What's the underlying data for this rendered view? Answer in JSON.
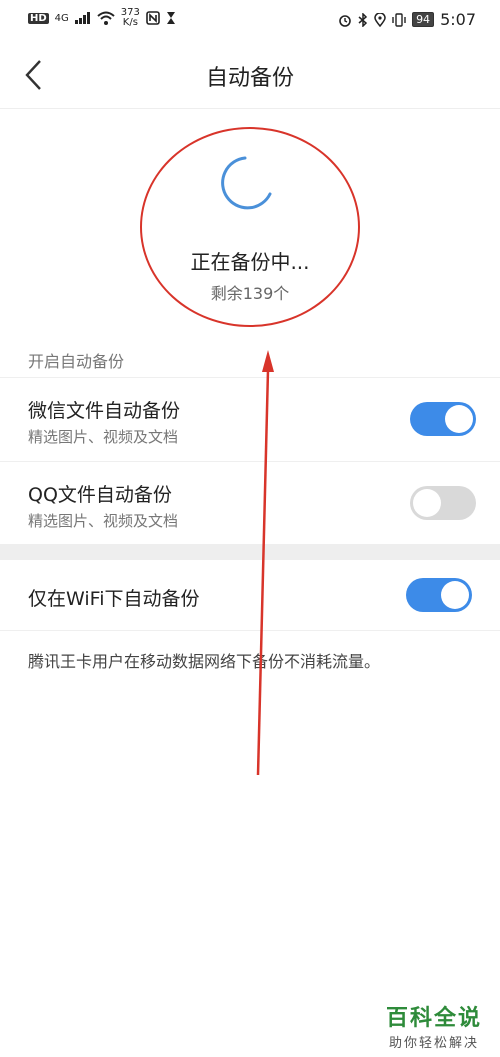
{
  "status_bar": {
    "network": "HD",
    "signal": "4G",
    "speed_value": "373",
    "speed_unit": "K/s",
    "battery": "94",
    "time": "5:07"
  },
  "nav": {
    "title": "自动备份"
  },
  "backup_status": {
    "text": "正在备份中...",
    "remaining": "剩余139个"
  },
  "section": {
    "header": "开启自动备份"
  },
  "rows": [
    {
      "title": "微信文件自动备份",
      "subtitle": "精选图片、视频及文档",
      "enabled": true
    },
    {
      "title": "QQ文件自动备份",
      "subtitle": "精选图片、视频及文档",
      "enabled": false
    }
  ],
  "wifi_row": {
    "title": "仅在WiFi下自动备份",
    "enabled": true
  },
  "footnote": "腾讯王卡用户在移动数据网络下备份不消耗流量。",
  "watermark": {
    "main": "百科全说",
    "sub": "助你轻松解决"
  },
  "colors": {
    "toggle_on": "#3d8be8",
    "toggle_off": "#d9d9d9",
    "annotation": "#d8342a",
    "spinner": "#4a90d9"
  }
}
